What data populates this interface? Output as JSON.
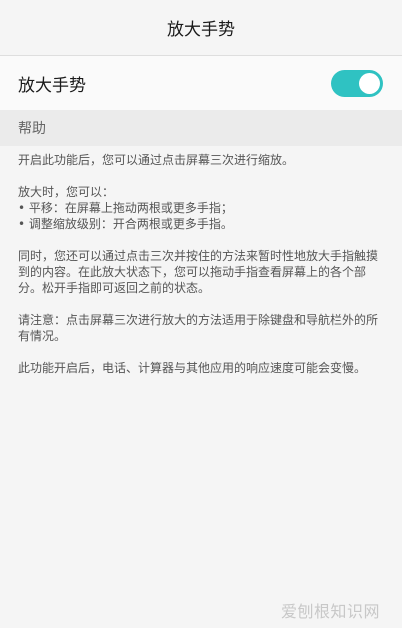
{
  "header": {
    "title": "放大手势"
  },
  "setting": {
    "label": "放大手势",
    "toggle_on": true,
    "accent": "#2fc2c2"
  },
  "help": {
    "section_title": "帮助",
    "p1": "开启此功能后，您可以通过点击屏幕三次进行缩放。",
    "p2_intro": "放大时，您可以：",
    "p2_item1": "• 平移：在屏幕上拖动两根或更多手指；",
    "p2_item2": "• 调整缩放级别：开合两根或更多手指。",
    "p3": "同时，您还可以通过点击三次并按住的方法来暂时性地放大手指触摸到的内容。在此放大状态下，您可以拖动手指查看屏幕上的各个部分。松开手指即可返回之前的状态。",
    "p4": "请注意：点击屏幕三次进行放大的方法适用于除键盘和导航栏外的所有情况。",
    "p5": "此功能开启后，电话、计算器与其他应用的响应速度可能会变慢。"
  },
  "watermark": "爱刨根知识网"
}
